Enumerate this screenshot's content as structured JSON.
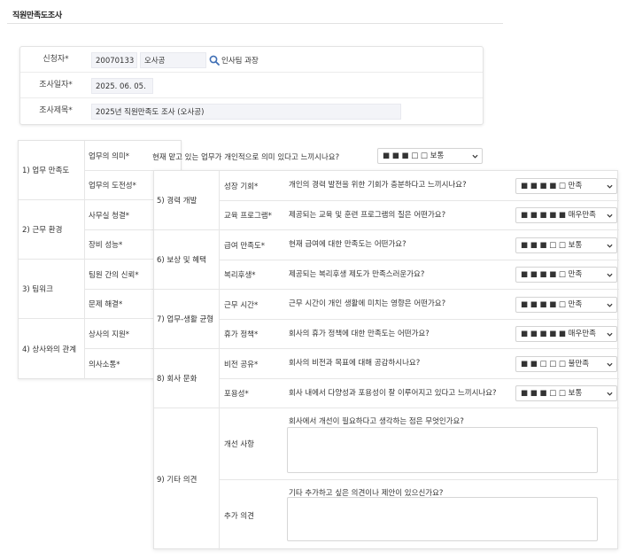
{
  "page_title": "직원만족도조사",
  "applicant": {
    "label": "신청자*",
    "id_value": "20070133",
    "name_value": "오사공",
    "dept": "인사팀 과장"
  },
  "survey_date": {
    "label": "조사일자*",
    "value": "2025. 06. 05."
  },
  "survey_title": {
    "label": "조사제목*",
    "value": "2025년 직원만족도 조사 (오사공)"
  },
  "left_categories": [
    {
      "label": "1) 업무 만족도",
      "subs": [
        "업무의 의미*",
        "업무의 도전성*"
      ]
    },
    {
      "label": "2) 근무 환경",
      "subs": [
        "사무실 청결*",
        "장비 성능*"
      ]
    },
    {
      "label": "3) 팀워크",
      "subs": [
        "팀원 간의 신뢰*",
        "문제 해결*"
      ]
    },
    {
      "label": "4) 상사와의 관계",
      "subs": [
        "상사의 지원*",
        "의사소통*"
      ]
    }
  ],
  "first_question": {
    "text": "현재 맡고 있는 업무가 개인적으로 의미 있다고 느끼시나요?",
    "rating": "■ ■ ■ □ □ 보통"
  },
  "right_categories": [
    {
      "label": "5) 경력 개발",
      "items": [
        {
          "sub": "성장 기회*",
          "question": "개인의 경력 발전을 위한 기회가 충분하다고 느끼시나요?",
          "rating": "■ ■ ■ ■ □ 만족"
        },
        {
          "sub": "교육 프로그램*",
          "question": "제공되는 교육 및 훈련 프로그램의 질은 어떤가요?",
          "rating": "■ ■ ■ ■ ■ 매우만족"
        }
      ]
    },
    {
      "label": "6) 보상 및 혜택",
      "items": [
        {
          "sub": "급여 만족도*",
          "question": "현재 급여에 대한 만족도는 어떤가요?",
          "rating": "■ ■ ■ □ □ 보통"
        },
        {
          "sub": "복리후생*",
          "question": "제공되는 복리후생 제도가 만족스러운가요?",
          "rating": "■ ■ ■ ■ □ 만족"
        }
      ]
    },
    {
      "label": "7) 업무-생활 균형",
      "items": [
        {
          "sub": "근무 시간*",
          "question": "근무 시간이 개인 생활에 미치는 영향은 어떤가요?",
          "rating": "■ ■ ■ ■ □ 만족"
        },
        {
          "sub": "휴가 정책*",
          "question": "회사의 휴가 정책에 대한 만족도는 어떤가요?",
          "rating": "■ ■ ■ ■ ■ 매우만족"
        }
      ]
    },
    {
      "label": "8) 회사 문화",
      "items": [
        {
          "sub": "비전 공유*",
          "question": "회사의 비전과 목표에 대해 공감하시나요?",
          "rating": "■ ■ □ □ □ 불만족"
        },
        {
          "sub": "포용성*",
          "question": "회사 내에서 다양성과 포용성이 잘 이루어지고 있다고 느끼시나요?",
          "rating": "■ ■ ■ □ □ 보통"
        }
      ]
    }
  ],
  "other": {
    "label": "9) 기타 의견",
    "improvement": {
      "sub": "개선 사항",
      "question": "회사에서 개선이 필요하다고 생각하는 점은 무엇인가요?",
      "value": ""
    },
    "additional": {
      "sub": "추가 의견",
      "question": "기타 추가하고 싶은 의견이나 제안이 있으신가요?",
      "value": ""
    }
  },
  "icons": {
    "search": "search-icon",
    "dropdown": "chevron-down-icon"
  },
  "colors": {
    "search_icon": "#3f6fb5",
    "field_bg": "#f3f4f8"
  }
}
